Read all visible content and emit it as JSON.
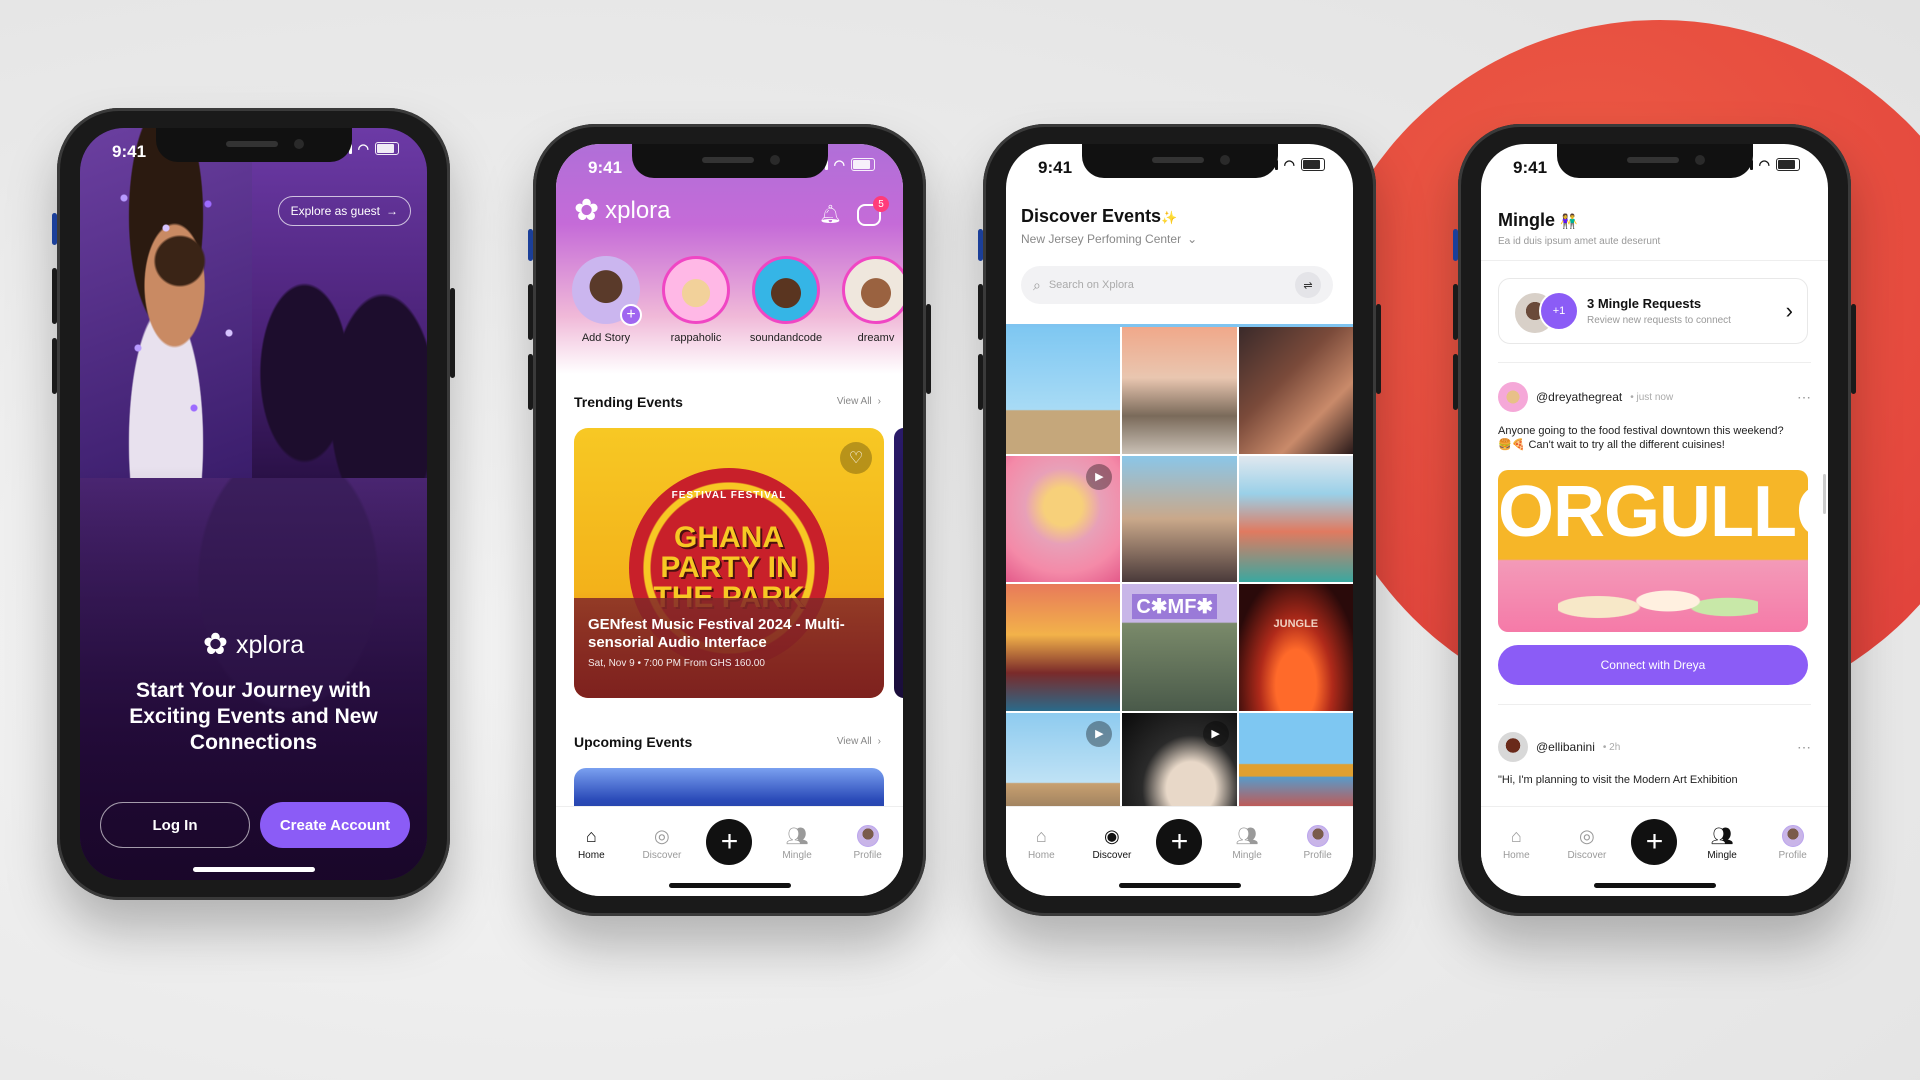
{
  "status_time": "9:41",
  "phone1": {
    "explore_guest": "Explore as guest",
    "brand": "xplora",
    "headline": "Start Your Journey with Exciting Events and New Connections",
    "login_label": "Log In",
    "create_label": "Create Account",
    "accent": "#8b5cf6"
  },
  "phone2": {
    "brand": "xplora",
    "notif_count": "5",
    "stories": [
      {
        "name": "Add Story"
      },
      {
        "name": "rappaholic"
      },
      {
        "name": "soundandcode"
      },
      {
        "name": "dreamv"
      }
    ],
    "trending_title": "Trending Events",
    "view_all": "View All",
    "poster_text": "GHANA PARTY IN THE PARK",
    "poster_ribbon": "FESTIVAL FESTIVAL",
    "event_title": "GENfest Music Festival 2024 - Multi-sensorial Audio Interface",
    "event_meta": "Sat, Nov 9 • 7:00 PM  From GHS 160.00",
    "upcoming_title": "Upcoming Events",
    "upcoming_view_all": "View All"
  },
  "phone3": {
    "title": "Discover Events",
    "sparkle": "✨",
    "location": "New Jersey Perfoming Center",
    "search_placeholder": "Search on Xplora",
    "tile_labels": {
      "comfy": "C✱MF✱",
      "jungle": "JUNGLE"
    }
  },
  "phone4": {
    "title": "Mingle",
    "title_emoji": "👫",
    "subtitle": "Ea id duis ipsum amet aute deserunt",
    "requests_badge": "+1",
    "requests_title": "3 Mingle Requests",
    "requests_sub": "Review new requests to connect",
    "post1": {
      "user": "@dreyathegreat",
      "time": "just now",
      "text": "Anyone going to the food festival downtown this weekend? 🍔🍕 Can't wait to try all the different cuisines!",
      "image_text": "ORGULLO",
      "cta": "Connect with Dreya"
    },
    "post2": {
      "user": "@ellibanini",
      "time": "2h",
      "text": "\"Hi, I'm planning to visit the Modern Art Exhibition"
    }
  },
  "tabs": {
    "home": "Home",
    "discover": "Discover",
    "mingle": "Mingle",
    "profile": "Profile"
  },
  "icons": [
    "home-icon",
    "compass-icon",
    "plus-icon",
    "people-icon",
    "avatar-icon",
    "bell-icon",
    "chat-icon",
    "search-icon",
    "filter-icon",
    "heart-icon",
    "chevron-right-icon",
    "chevron-down-icon",
    "play-icon",
    "more-icon",
    "arrow-right-icon"
  ]
}
